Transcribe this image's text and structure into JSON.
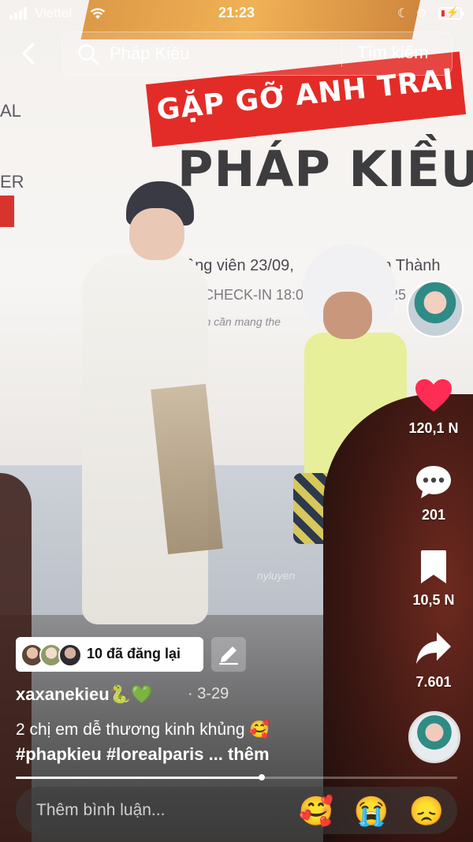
{
  "status_bar": {
    "carrier": "Viettel",
    "time": "21:23",
    "battery_level": 0.2
  },
  "header": {
    "search_query": "Pháp Kiều",
    "search_button": "Tìm kiếm"
  },
  "video": {
    "banner_red_text": "GẶP GỠ ANH TRAI",
    "banner_title": "PHÁP KIỀU",
    "banner_sub1": "ộng viên 23/09, ",
    "banner_sub1_end": "ến Thành",
    "banner_sub2": "CHECK-IN 18:0",
    "banner_sub2_end": "25",
    "banner_sub3": ", checkin cần mang the",
    "banner_left1": "AL",
    "banner_left2": "ER",
    "watermark": "nyluyen"
  },
  "actions": {
    "likes": "120,1 N",
    "comments": "201",
    "saves": "10,5 N",
    "shares": "7.601"
  },
  "post": {
    "reposts_label": "10 đã đăng lại",
    "username": "xaxanekieu",
    "username_emojis": "🐍💚",
    "date_sep": "·",
    "date": "3-29",
    "caption": "2 chị em dễ thương kinh khủng",
    "caption_emoji": "🥰",
    "hashtags": "#phapkieu #lorealparis",
    "more": "... thêm",
    "progress": 0.557
  },
  "comment_bar": {
    "placeholder": "Thêm bình luận...",
    "emoji_1": "🥰",
    "emoji_2": "😭",
    "emoji_3": "😞"
  },
  "icons": {
    "back": "chevron-left-icon",
    "search": "search-icon",
    "like": "heart-icon",
    "comment": "speech-bubble-icon",
    "save": "bookmark-icon",
    "share": "share-arrow-icon",
    "edit": "pencil-icon"
  },
  "colors": {
    "like": "#ff2d55",
    "battery": "#e33a2f",
    "banner_red": "#e32c27"
  }
}
